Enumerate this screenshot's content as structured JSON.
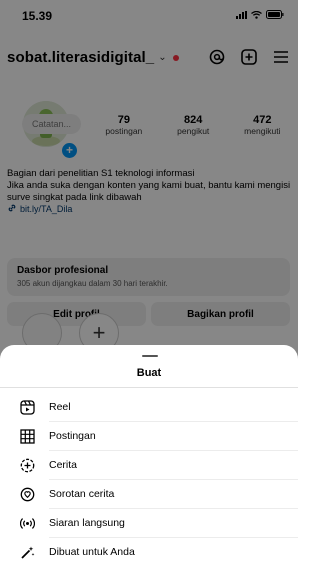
{
  "status": {
    "time": "15.39"
  },
  "profile": {
    "username": "sobat.literasidigital_",
    "note": "Catatan...",
    "stats": [
      {
        "num": "79",
        "label": "postingan"
      },
      {
        "num": "824",
        "label": "pengikut"
      },
      {
        "num": "472",
        "label": "mengikuti"
      }
    ],
    "bio_line1": "Bagian dari penelitian S1 teknologi informasi",
    "bio_line2": "Jika anda suka dengan konten yang kami buat, bantu kami mengisi surve singkat pada link dibawah",
    "link": "bit.ly/TA_Dila",
    "dashboard_title": "Dasbor profesional",
    "dashboard_sub": "305 akun dijangkau dalam 30 hari terakhir.",
    "edit_label": "Edit profil",
    "share_label": "Bagikan profil"
  },
  "sheet": {
    "title": "Buat",
    "items": [
      {
        "label": "Reel",
        "icon": "reel-icon"
      },
      {
        "label": "Postingan",
        "icon": "grid-icon"
      },
      {
        "label": "Cerita",
        "icon": "story-plus-icon"
      },
      {
        "label": "Sorotan cerita",
        "icon": "highlight-icon"
      },
      {
        "label": "Siaran langsung",
        "icon": "live-icon"
      },
      {
        "label": "Dibuat untuk Anda",
        "icon": "magic-wand-icon"
      }
    ]
  },
  "colors": {
    "accent": "#0095f6",
    "notification": "#ff3040",
    "link": "#00376b",
    "overlay": "rgba(0,0,0,0.47)"
  }
}
